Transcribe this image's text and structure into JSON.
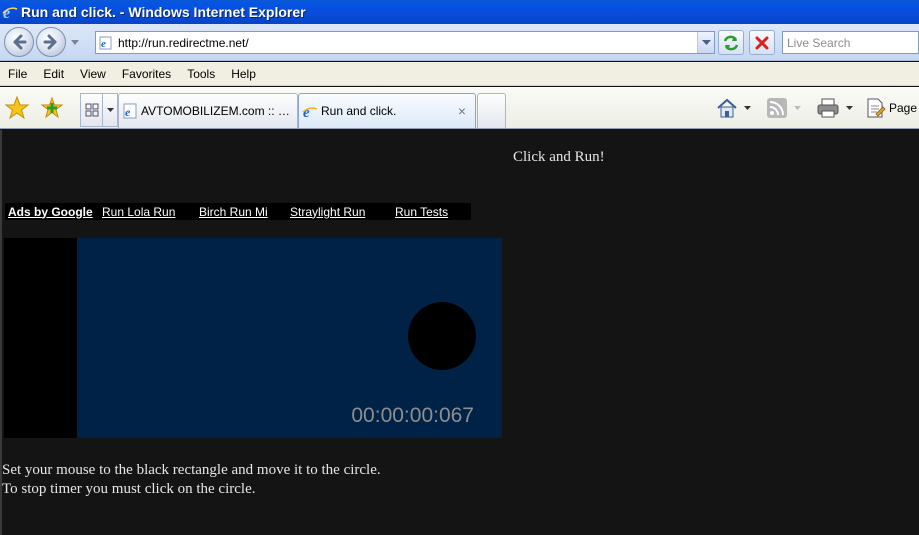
{
  "window": {
    "title": "Run and click. - Windows Internet Explorer"
  },
  "address_bar": {
    "url": "http://run.redirectme.net/",
    "search_placeholder": "Live Search"
  },
  "menu": {
    "items": [
      "File",
      "Edit",
      "View",
      "Favorites",
      "Tools",
      "Help"
    ]
  },
  "tabs": [
    {
      "label": "AVTOMOBILIZEM.com :: Pogl...",
      "active": false
    },
    {
      "label": "Run and click.",
      "active": true
    }
  ],
  "command_bar": {
    "page_label": "Page"
  },
  "page": {
    "heading": "Click and Run!",
    "ads_label": "Ads by Google",
    "ad_links": [
      "Run Lola Run",
      "Birch Run Mi",
      "Straylight Run",
      "Run Tests"
    ],
    "timer": "00:00:00:067",
    "instructions": [
      "Set your mouse to the black rectangle and move it to the circle.",
      "To stop timer you must click on the circle."
    ]
  },
  "colors": {
    "titlebar": "#0553e4",
    "page_background": "#141414",
    "play_field": "#002246",
    "timer_text": "#8e8e8e"
  }
}
